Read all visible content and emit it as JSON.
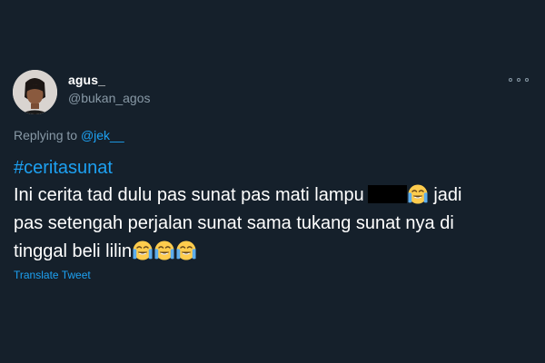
{
  "tweet": {
    "display_name": "agus_",
    "handle": "@bukan_agos",
    "more_icon": "more-horizontal-icon",
    "replying_prefix": "Replying to",
    "replying_to": "@jek__",
    "hashtag": "#ceritasunat",
    "body_line1": "Ini cerita tad dulu pas sunat pas mati lampu",
    "body_line1_after": "jadi",
    "body_line2": "pas setengah perjalan sunat sama tukang sunat nya di",
    "body_line3": "tinggal beli lilin",
    "emoji": "loudly-crying-face",
    "translate_label": "Translate Tweet"
  },
  "colors": {
    "background": "#15202b",
    "text": "#ffffff",
    "secondary_text": "#8899a6",
    "link": "#1da1f2"
  }
}
